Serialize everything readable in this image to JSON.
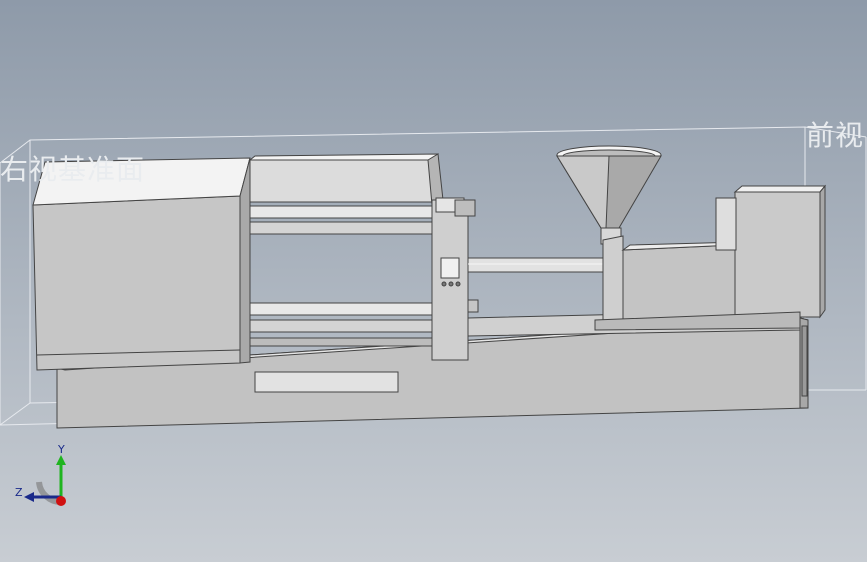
{
  "viewport": {
    "background_top": "#8e9aa9",
    "background_bottom": "#c8cdd3",
    "model_color": "#c9c9c9"
  },
  "planes": {
    "right_plane_label": "右视基准面",
    "front_plane_label": "前视"
  },
  "triad": {
    "y_label": "Y",
    "z_label": "Z",
    "y_color": "#1fb41f",
    "z_color": "#1a2a8a",
    "origin_color": "#d01010"
  }
}
